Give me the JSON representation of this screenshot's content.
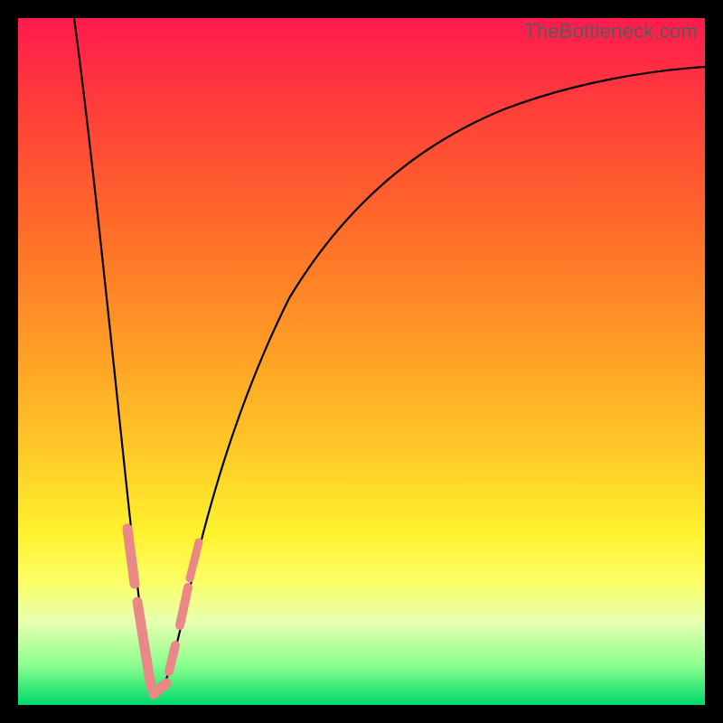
{
  "watermark": "TheBottleneck.com",
  "colors": {
    "bead": "#e98886",
    "line": "#000000"
  },
  "chart_data": {
    "type": "line",
    "title": "",
    "xlabel": "",
    "ylabel": "",
    "xlim": [
      0,
      100
    ],
    "ylim": [
      0,
      100
    ],
    "grid": false,
    "note": "Bottleneck-style curve: y is bottleneck percentage, x is relative performance. Minimum near x≈19. Values estimated from pixel positions against implied 0–100 axes.",
    "series": [
      {
        "name": "bottleneck-curve",
        "x": [
          8,
          10,
          12,
          14,
          16,
          17,
          18,
          19,
          20,
          22,
          24,
          26,
          30,
          35,
          40,
          50,
          60,
          70,
          80,
          90,
          100
        ],
        "y": [
          100,
          80,
          58,
          36,
          18,
          10,
          4,
          1,
          3,
          11,
          22,
          33,
          49,
          62,
          71,
          82,
          88,
          92,
          95,
          97,
          98
        ]
      }
    ],
    "beads": {
      "note": "Short highlighted segments (pink) near the valley, read off as approximate data markers.",
      "segments": [
        {
          "x": [
            14.5,
            15.8
          ],
          "y": [
            23,
            15
          ]
        },
        {
          "x": [
            16.3,
            18.5
          ],
          "y": [
            12,
            2
          ]
        },
        {
          "x": [
            18.8,
            20.2
          ],
          "y": [
            1,
            3
          ]
        },
        {
          "x": [
            20.8,
            21.6
          ],
          "y": [
            6,
            9
          ]
        },
        {
          "x": [
            22.4,
            23.4
          ],
          "y": [
            14,
            19
          ]
        },
        {
          "x": [
            23.8,
            24.8
          ],
          "y": [
            21,
            26
          ]
        }
      ]
    }
  }
}
